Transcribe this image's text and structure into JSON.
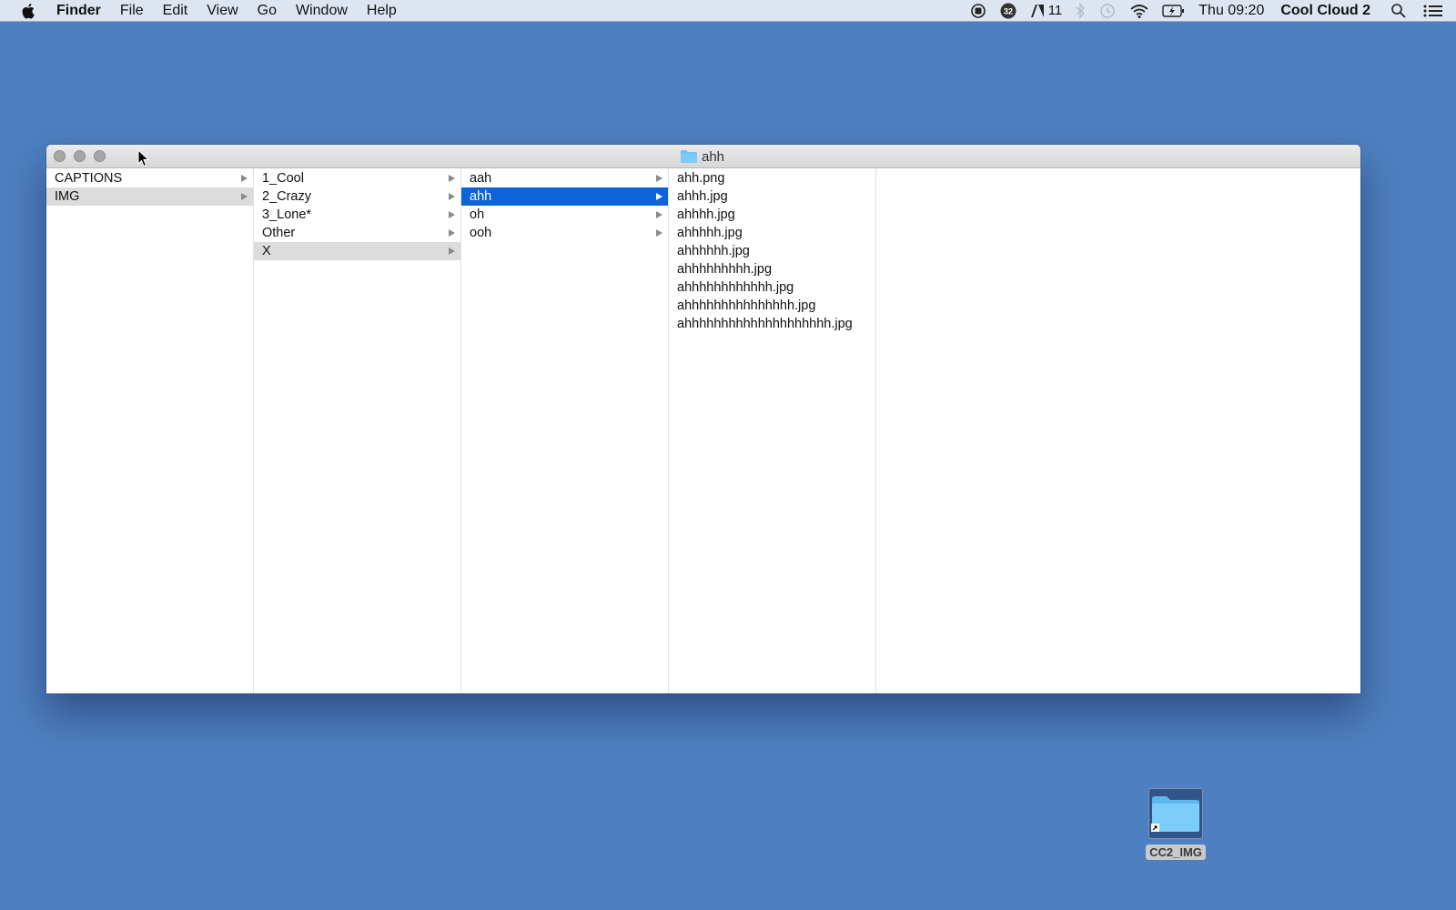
{
  "menubar": {
    "app_name": "Finder",
    "menus": [
      "File",
      "Edit",
      "View",
      "Go",
      "Window",
      "Help"
    ],
    "status_items": {
      "adobe_count": "11",
      "clock": "Thu 09:20",
      "user": "Cool Cloud 2"
    }
  },
  "window": {
    "title": "ahh",
    "columns": [
      {
        "items": [
          {
            "label": "CAPTIONS",
            "folder": true,
            "state": "normal"
          },
          {
            "label": "IMG",
            "folder": true,
            "state": "path"
          }
        ]
      },
      {
        "items": [
          {
            "label": "1_Cool",
            "folder": true,
            "state": "normal"
          },
          {
            "label": "2_Crazy",
            "folder": true,
            "state": "normal"
          },
          {
            "label": "3_Lone*",
            "folder": true,
            "state": "normal"
          },
          {
            "label": "Other",
            "folder": true,
            "state": "normal"
          },
          {
            "label": "X",
            "folder": true,
            "state": "path"
          }
        ]
      },
      {
        "items": [
          {
            "label": "aah",
            "folder": true,
            "state": "normal"
          },
          {
            "label": "ahh",
            "folder": true,
            "state": "selected"
          },
          {
            "label": "oh",
            "folder": true,
            "state": "normal"
          },
          {
            "label": "ooh",
            "folder": true,
            "state": "normal"
          }
        ]
      },
      {
        "items": [
          {
            "label": "ahh.png",
            "folder": false,
            "state": "normal"
          },
          {
            "label": "ahhh.jpg",
            "folder": false,
            "state": "normal"
          },
          {
            "label": "ahhhh.jpg",
            "folder": false,
            "state": "normal"
          },
          {
            "label": "ahhhhh.jpg",
            "folder": false,
            "state": "normal"
          },
          {
            "label": "ahhhhhh.jpg",
            "folder": false,
            "state": "normal"
          },
          {
            "label": "ahhhhhhhhh.jpg",
            "folder": false,
            "state": "normal"
          },
          {
            "label": "ahhhhhhhhhhhh.jpg",
            "folder": false,
            "state": "normal"
          },
          {
            "label": "ahhhhhhhhhhhhhhh.jpg",
            "folder": false,
            "state": "normal"
          },
          {
            "label": "ahhhhhhhhhhhhhhhhhhhh.jpg",
            "folder": false,
            "state": "normal"
          }
        ]
      },
      {
        "items": []
      }
    ]
  },
  "desktop": {
    "icons": [
      {
        "label": "CC2_IMG",
        "type": "folder-alias"
      }
    ]
  },
  "colors": {
    "desktop": "#4e7fc0",
    "selection": "#0e63d8",
    "path_highlight": "#dcdcdc",
    "folder": "#6ec2f5"
  }
}
